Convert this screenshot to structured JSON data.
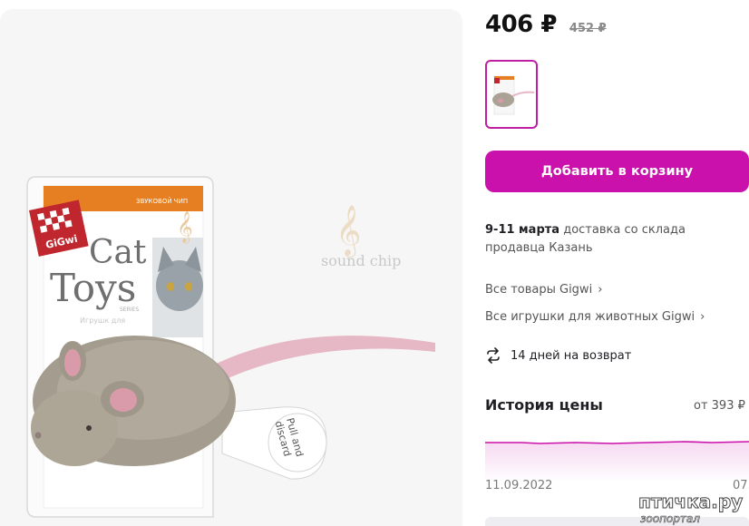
{
  "product": {
    "price": "406 ₽",
    "old_price": "452 ₽",
    "image": {
      "package_brand": "GiGwi",
      "package_badge": "ЗВУКОВОЙ ЧИП",
      "package_title_1": "Cat",
      "package_title_2": "Toys",
      "package_series": "SERIES",
      "package_subtitle": "Игрушк для",
      "sound_chip_label": "sound chip",
      "tag_text_1": "Pull and",
      "tag_text_2": "discard"
    }
  },
  "actions": {
    "add_to_cart": "Добавить в корзину"
  },
  "delivery": {
    "date": "9-11 марта",
    "text": "доставка со склада продавца Казань"
  },
  "links": {
    "all_products": "Все товары Gigwi",
    "all_toys": "Все игрушки для животных Gigwi"
  },
  "returns": {
    "text": "14 дней на возврат"
  },
  "price_history": {
    "title": "История цены",
    "from_label": "от 393 ₽ д",
    "start_date": "11.09.2022",
    "end_date": "07.",
    "color": "#cb11ab"
  },
  "watermark": {
    "title": "птичка.ру",
    "subtitle": "зоопортал"
  },
  "colors": {
    "accent": "#cb11ab",
    "photo_bg": "#f6f6f6"
  }
}
